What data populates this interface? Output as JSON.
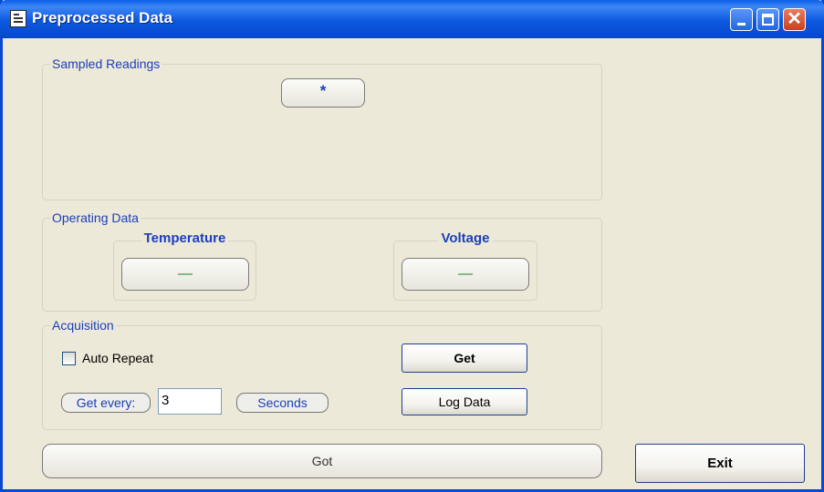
{
  "window": {
    "title": "Preprocessed Data"
  },
  "sampled_readings": {
    "label": "Sampled Readings",
    "value": "*"
  },
  "operating_data": {
    "label": "Operating Data",
    "temperature": {
      "label": "Temperature",
      "value": "—"
    },
    "voltage": {
      "label": "Voltage",
      "value": "—"
    }
  },
  "acquisition": {
    "label": "Acquisition",
    "auto_repeat_label": "Auto Repeat",
    "auto_repeat_checked": false,
    "get_label": "Get",
    "get_every_label": "Get every:",
    "interval_value": "3",
    "seconds_label": "Seconds",
    "log_data_label": "Log Data"
  },
  "status": {
    "text": "Got"
  },
  "exit_label": "Exit",
  "colors": {
    "titlebar": "#0b58e0",
    "window_bg": "#ece9d8",
    "label_blue": "#1c3fb8",
    "value_green": "#2a8a2a"
  }
}
